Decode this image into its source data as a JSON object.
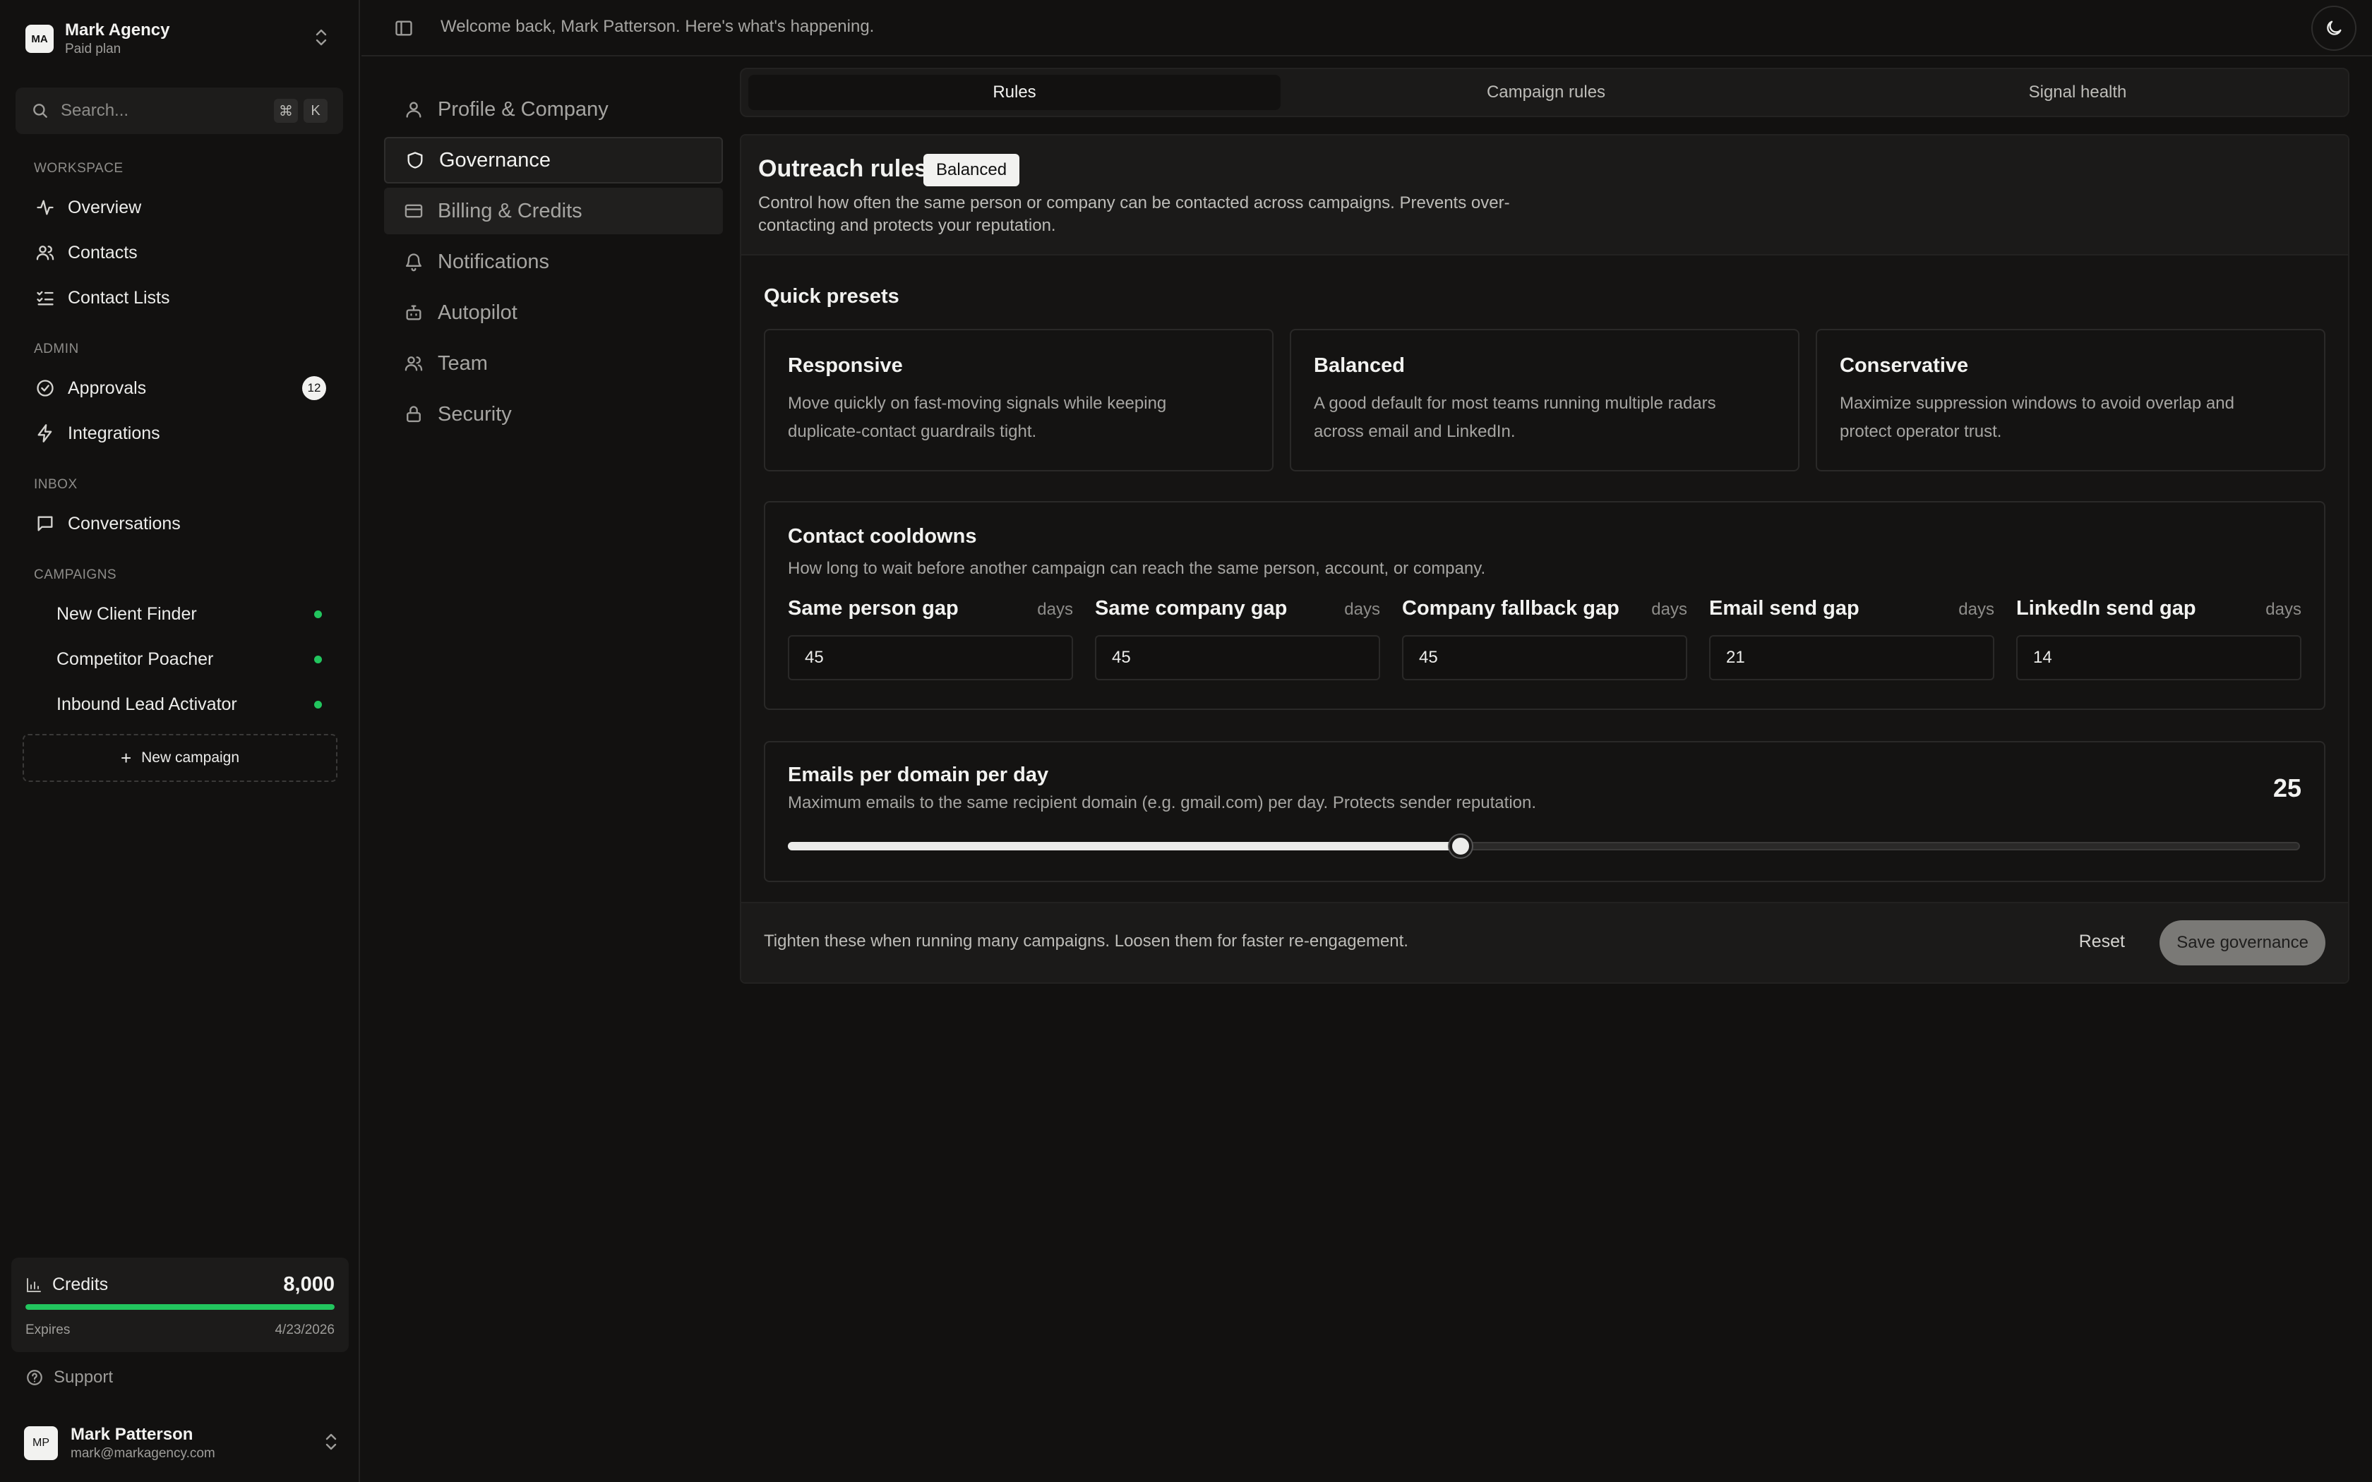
{
  "org": {
    "initials": "MA",
    "name": "Mark Agency",
    "plan": "Paid plan"
  },
  "search": {
    "placeholder": "Search...",
    "kbd_cmd": "⌘",
    "kbd_key": "K"
  },
  "sidebar": {
    "workspace_title": "WORKSPACE",
    "workspace_items": [
      {
        "label": "Overview",
        "icon": "activity-icon"
      },
      {
        "label": "Contacts",
        "icon": "users-icon"
      },
      {
        "label": "Contact Lists",
        "icon": "list-checks-icon"
      }
    ],
    "admin_title": "ADMIN",
    "admin_items": [
      {
        "label": "Approvals",
        "icon": "check-circle-icon",
        "badge": "12"
      },
      {
        "label": "Integrations",
        "icon": "zap-icon"
      }
    ],
    "inbox_title": "INBOX",
    "inbox_items": [
      {
        "label": "Conversations",
        "icon": "message-square-icon"
      }
    ],
    "campaigns_title": "CAMPAIGNS",
    "campaigns": [
      {
        "label": "New Client Finder",
        "status_color": "#22c55e"
      },
      {
        "label": "Competitor Poacher",
        "status_color": "#22c55e"
      },
      {
        "label": "Inbound Lead Activator",
        "status_color": "#22c55e"
      }
    ],
    "new_campaign": "New campaign"
  },
  "credits": {
    "label": "Credits",
    "value": "8,000",
    "expires_label": "Expires",
    "expires_date": "4/23/2026",
    "remaining_fraction": 1.0
  },
  "support": "Support",
  "user": {
    "initials": "MP",
    "name": "Mark Patterson",
    "email": "mark@markagency.com"
  },
  "topbar": {
    "welcome": "Welcome back, Mark Patterson. Here's what's happening."
  },
  "settings_nav": [
    {
      "label": "Profile & Company",
      "icon": "user-icon"
    },
    {
      "label": "Governance",
      "icon": "shield-icon",
      "active": true
    },
    {
      "label": "Billing & Credits",
      "icon": "credit-card-icon"
    },
    {
      "label": "Notifications",
      "icon": "bell-icon"
    },
    {
      "label": "Autopilot",
      "icon": "bot-icon"
    },
    {
      "label": "Team",
      "icon": "users-icon"
    },
    {
      "label": "Security",
      "icon": "lock-icon"
    }
  ],
  "tabs": [
    {
      "label": "Rules",
      "active": true
    },
    {
      "label": "Campaign rules"
    },
    {
      "label": "Signal health"
    }
  ],
  "outreach": {
    "title": "Outreach rules",
    "badge": "Balanced",
    "description": "Control how often the same person or company can be contacted across campaigns. Prevents over-contacting and protects your reputation."
  },
  "presets": {
    "title": "Quick presets",
    "items": [
      {
        "title": "Responsive",
        "description": "Move quickly on fast-moving signals while keeping duplicate-contact guardrails tight."
      },
      {
        "title": "Balanced",
        "description": "A good default for most teams running multiple radars across email and LinkedIn."
      },
      {
        "title": "Conservative",
        "description": "Maximize suppression windows to avoid overlap and protect operator trust."
      }
    ]
  },
  "cooldowns": {
    "title": "Contact cooldowns",
    "subtitle": "How long to wait before another campaign can reach the same person, account, or company.",
    "fields": [
      {
        "label": "Same person gap",
        "unit": "days",
        "value": "45"
      },
      {
        "label": "Same company gap",
        "unit": "days",
        "value": "45"
      },
      {
        "label": "Company fallback gap",
        "unit": "days",
        "value": "45"
      },
      {
        "label": "Email send gap",
        "unit": "days",
        "value": "21"
      },
      {
        "label": "LinkedIn send gap",
        "unit": "days",
        "value": "14"
      }
    ]
  },
  "domain_limit": {
    "title": "Emails per domain per day",
    "subtitle": "Maximum emails to the same recipient domain (e.g. gmail.com) per day. Protects sender reputation.",
    "value": "25",
    "slider_fraction": 0.445
  },
  "footer": {
    "hint": "Tighten these when running many campaigns. Loosen them for faster re-engagement.",
    "reset": "Reset",
    "save": "Save governance"
  }
}
